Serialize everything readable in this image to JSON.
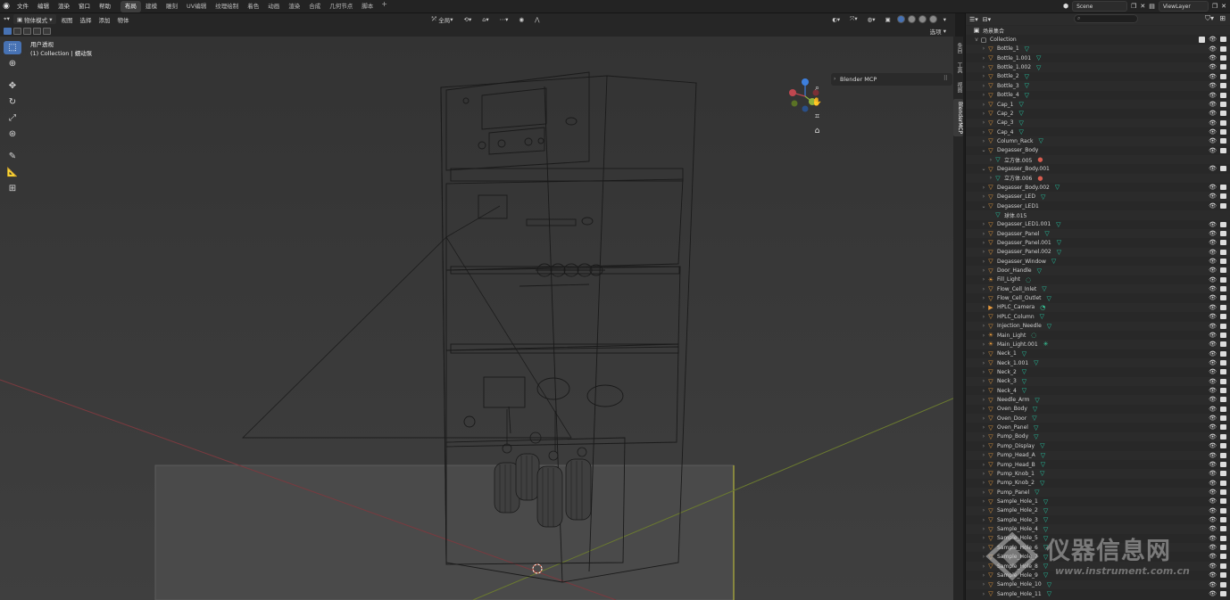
{
  "menu": {
    "items": [
      "文件",
      "编辑",
      "渲染",
      "窗口",
      "帮助"
    ],
    "workspaces": [
      "布局",
      "建模",
      "雕刻",
      "UV编辑",
      "纹理绘制",
      "着色",
      "动画",
      "渲染",
      "合成",
      "几何节点",
      "脚本"
    ],
    "active_workspace": "布局",
    "add_label": "+",
    "scene_label": "Scene",
    "view_layer_label": "ViewLayer"
  },
  "viewport_header": {
    "mode": "物体模式",
    "menus": [
      "视图",
      "选择",
      "添加",
      "物体"
    ],
    "transform_orientation": "全局",
    "options_label": "选项"
  },
  "viewport": {
    "info_line1": "用户透视",
    "info_line2": "(1) Collection | 蠕动泵"
  },
  "npanel": {
    "title": "Blender MCP",
    "tabs": [
      "条目",
      "工具",
      "视图",
      "BlenderMCP"
    ]
  },
  "outliner": {
    "search_placeholder": "",
    "root_label": "场景集合",
    "collection_label": "Collection",
    "rows": [
      {
        "name": "Bottle_1",
        "type": "mesh",
        "depth": 2,
        "exp": ">",
        "data": "mesh"
      },
      {
        "name": "Bottle_1.001",
        "type": "mesh",
        "depth": 2,
        "exp": ">",
        "data": "mesh"
      },
      {
        "name": "Bottle_1.002",
        "type": "mesh",
        "depth": 2,
        "exp": ">",
        "data": "mesh"
      },
      {
        "name": "Bottle_2",
        "type": "mesh",
        "depth": 2,
        "exp": ">",
        "data": "mesh"
      },
      {
        "name": "Bottle_3",
        "type": "mesh",
        "depth": 2,
        "exp": ">",
        "data": "mesh"
      },
      {
        "name": "Bottle_4",
        "type": "mesh",
        "depth": 2,
        "exp": ">",
        "data": "mesh"
      },
      {
        "name": "Cap_1",
        "type": "mesh",
        "depth": 2,
        "exp": ">",
        "data": "mesh"
      },
      {
        "name": "Cap_2",
        "type": "mesh",
        "depth": 2,
        "exp": ">",
        "data": "mesh"
      },
      {
        "name": "Cap_3",
        "type": "mesh",
        "depth": 2,
        "exp": ">",
        "data": "mesh"
      },
      {
        "name": "Cap_4",
        "type": "mesh",
        "depth": 2,
        "exp": ">",
        "data": "mesh"
      },
      {
        "name": "Column_Rack",
        "type": "mesh",
        "depth": 2,
        "exp": ">",
        "data": "mesh"
      },
      {
        "name": "Degasser_Body",
        "type": "mesh",
        "depth": 2,
        "exp": "v",
        "data": ""
      },
      {
        "name": "立方体.005",
        "type": "meshdata",
        "depth": 3,
        "exp": ">",
        "data": "mat"
      },
      {
        "name": "Degasser_Body.001",
        "type": "mesh",
        "depth": 2,
        "exp": "v",
        "data": ""
      },
      {
        "name": "立方体.006",
        "type": "meshdata",
        "depth": 3,
        "exp": ">",
        "data": "mat"
      },
      {
        "name": "Degasser_Body.002",
        "type": "mesh",
        "depth": 2,
        "exp": ">",
        "data": "mesh"
      },
      {
        "name": "Degasser_LED",
        "type": "mesh",
        "depth": 2,
        "exp": ">",
        "data": "mesh"
      },
      {
        "name": "Degasser_LED1",
        "type": "mesh",
        "depth": 2,
        "exp": "v",
        "data": ""
      },
      {
        "name": "球体.015",
        "type": "meshdata",
        "depth": 3,
        "exp": "",
        "data": ""
      },
      {
        "name": "Degasser_LED1.001",
        "type": "mesh",
        "depth": 2,
        "exp": ">",
        "data": "mesh"
      },
      {
        "name": "Degasser_Panel",
        "type": "mesh",
        "depth": 2,
        "exp": ">",
        "data": "mesh"
      },
      {
        "name": "Degasser_Panel.001",
        "type": "mesh",
        "depth": 2,
        "exp": ">",
        "data": "mesh"
      },
      {
        "name": "Degasser_Panel.002",
        "type": "mesh",
        "depth": 2,
        "exp": ">",
        "data": "mesh"
      },
      {
        "name": "Degasser_Window",
        "type": "mesh",
        "depth": 2,
        "exp": ">",
        "data": "mesh"
      },
      {
        "name": "Door_Handle",
        "type": "mesh",
        "depth": 2,
        "exp": ">",
        "data": "mesh"
      },
      {
        "name": "Fill_Light",
        "type": "light",
        "depth": 2,
        "exp": ">",
        "data": "light"
      },
      {
        "name": "Flow_Cell_Inlet",
        "type": "mesh",
        "depth": 2,
        "exp": ">",
        "data": "mesh"
      },
      {
        "name": "Flow_Cell_Outlet",
        "type": "mesh",
        "depth": 2,
        "exp": ">",
        "data": "mesh"
      },
      {
        "name": "HPLC_Camera",
        "type": "camera",
        "depth": 2,
        "exp": ">",
        "data": "cam"
      },
      {
        "name": "HPLC_Column",
        "type": "mesh",
        "depth": 2,
        "exp": ">",
        "data": "mesh"
      },
      {
        "name": "Injection_Needle",
        "type": "mesh",
        "depth": 2,
        "exp": ">",
        "data": "mesh"
      },
      {
        "name": "Main_Light",
        "type": "light",
        "depth": 2,
        "exp": ">",
        "data": "light"
      },
      {
        "name": "Main_Light.001",
        "type": "light",
        "depth": 2,
        "exp": ">",
        "data": "sun"
      },
      {
        "name": "Neck_1",
        "type": "mesh",
        "depth": 2,
        "exp": ">",
        "data": "mesh"
      },
      {
        "name": "Neck_1.001",
        "type": "mesh",
        "depth": 2,
        "exp": ">",
        "data": "mesh"
      },
      {
        "name": "Neck_2",
        "type": "mesh",
        "depth": 2,
        "exp": ">",
        "data": "mesh"
      },
      {
        "name": "Neck_3",
        "type": "mesh",
        "depth": 2,
        "exp": ">",
        "data": "mesh"
      },
      {
        "name": "Neck_4",
        "type": "mesh",
        "depth": 2,
        "exp": ">",
        "data": "mesh"
      },
      {
        "name": "Needle_Arm",
        "type": "mesh",
        "depth": 2,
        "exp": ">",
        "data": "mesh"
      },
      {
        "name": "Oven_Body",
        "type": "mesh",
        "depth": 2,
        "exp": ">",
        "data": "mesh"
      },
      {
        "name": "Oven_Door",
        "type": "mesh",
        "depth": 2,
        "exp": ">",
        "data": "mesh"
      },
      {
        "name": "Oven_Panel",
        "type": "mesh",
        "depth": 2,
        "exp": ">",
        "data": "mesh"
      },
      {
        "name": "Pump_Body",
        "type": "mesh",
        "depth": 2,
        "exp": ">",
        "data": "mesh"
      },
      {
        "name": "Pump_Display",
        "type": "mesh",
        "depth": 2,
        "exp": ">",
        "data": "mesh"
      },
      {
        "name": "Pump_Head_A",
        "type": "mesh",
        "depth": 2,
        "exp": ">",
        "data": "mesh"
      },
      {
        "name": "Pump_Head_B",
        "type": "mesh",
        "depth": 2,
        "exp": ">",
        "data": "mesh"
      },
      {
        "name": "Pump_Knob_1",
        "type": "mesh",
        "depth": 2,
        "exp": ">",
        "data": "mesh"
      },
      {
        "name": "Pump_Knob_2",
        "type": "mesh",
        "depth": 2,
        "exp": ">",
        "data": "mesh"
      },
      {
        "name": "Pump_Panel",
        "type": "mesh",
        "depth": 2,
        "exp": ">",
        "data": "mesh"
      },
      {
        "name": "Sample_Hole_1",
        "type": "mesh",
        "depth": 2,
        "exp": ">",
        "data": "mesh"
      },
      {
        "name": "Sample_Hole_2",
        "type": "mesh",
        "depth": 2,
        "exp": ">",
        "data": "mesh"
      },
      {
        "name": "Sample_Hole_3",
        "type": "mesh",
        "depth": 2,
        "exp": ">",
        "data": "mesh"
      },
      {
        "name": "Sample_Hole_4",
        "type": "mesh",
        "depth": 2,
        "exp": ">",
        "data": "mesh"
      },
      {
        "name": "Sample_Hole_5",
        "type": "mesh",
        "depth": 2,
        "exp": ">",
        "data": "mesh"
      },
      {
        "name": "Sample_Hole_6",
        "type": "mesh",
        "depth": 2,
        "exp": ">",
        "data": "mesh"
      },
      {
        "name": "Sample_Hole_7",
        "type": "mesh",
        "depth": 2,
        "exp": ">",
        "data": "mesh"
      },
      {
        "name": "Sample_Hole_8",
        "type": "mesh",
        "depth": 2,
        "exp": ">",
        "data": "mesh"
      },
      {
        "name": "Sample_Hole_9",
        "type": "mesh",
        "depth": 2,
        "exp": ">",
        "data": "mesh"
      },
      {
        "name": "Sample_Hole_10",
        "type": "mesh",
        "depth": 2,
        "exp": ">",
        "data": "mesh"
      },
      {
        "name": "Sample_Hole_11",
        "type": "mesh",
        "depth": 2,
        "exp": ">",
        "data": "mesh"
      }
    ]
  },
  "watermark": {
    "title": "仪器信息网",
    "url": "www.instrument.com.cn"
  },
  "colors": {
    "accent": "#4772b3",
    "mesh_icon": "#e89a3c",
    "mesh_data": "#23c8a4",
    "material": "#d65c4f",
    "axis_x": "#c0474f",
    "axis_y": "#8fb33a",
    "axis_z": "#3d7fdd"
  }
}
